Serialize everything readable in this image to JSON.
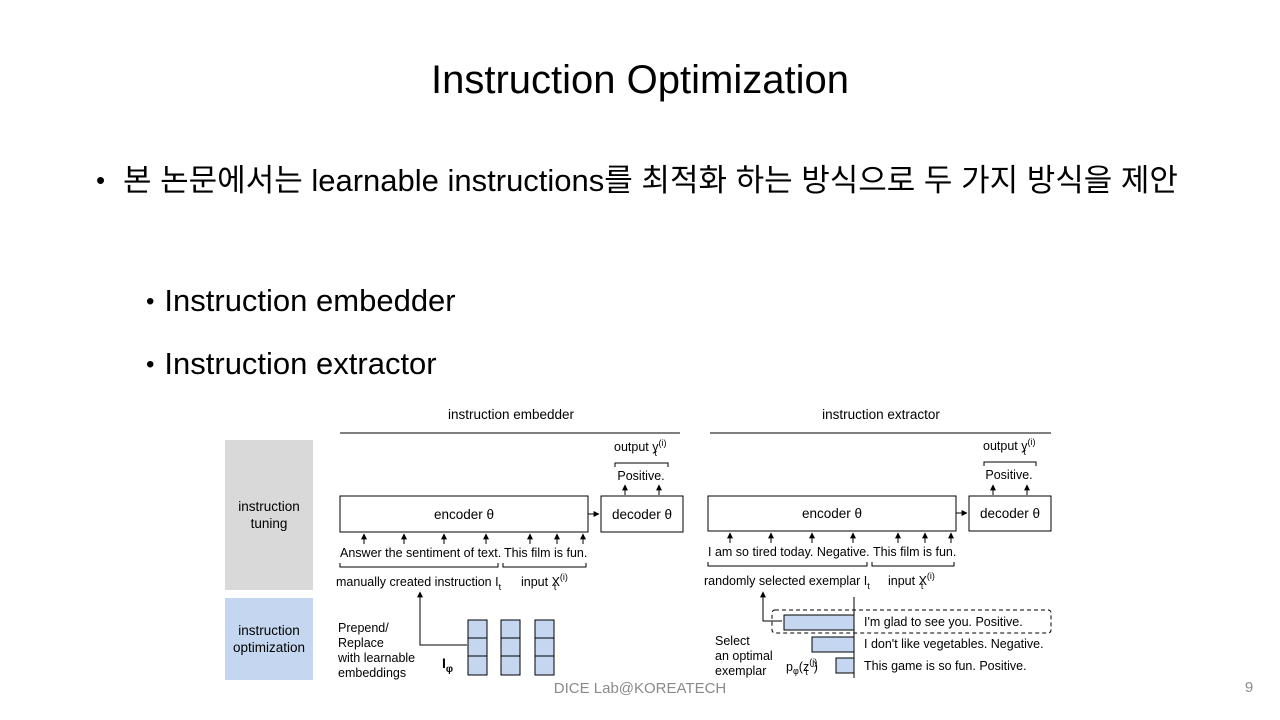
{
  "slide": {
    "title": "Instruction Optimization",
    "bullet": "본 논문에서는 learnable instructions를 최적화 하는 방식으로 두 가지 방식을 제안",
    "sub_bullets": [
      "Instruction embedder",
      "Instruction extractor"
    ],
    "footer": "DICE Lab@KOREATECH",
    "page_number": "9"
  },
  "figure": {
    "row_labels": {
      "tuning": [
        "instruction",
        "tuning"
      ],
      "optimization": [
        "instruction",
        "optimization"
      ]
    },
    "embedder": {
      "heading": "instruction embedder",
      "encoder": "encoder θ",
      "decoder": "decoder θ",
      "output_label": "output y",
      "output_sup": "(i)",
      "output_sub": "t",
      "output_value": "Positive.",
      "instruction_text": "Answer the sentiment of text.",
      "input_text": "This film is fun.",
      "instruction_caption": "manually created instruction I",
      "instruction_sub": "t",
      "input_caption": "input X",
      "input_sup": "(i)",
      "input_sub": "t",
      "opt_text": [
        "Prepend/",
        "Replace",
        "with learnable",
        "embeddings"
      ],
      "param_label": "I",
      "param_sub": "φ"
    },
    "extractor": {
      "heading": "instruction extractor",
      "encoder": "encoder θ",
      "decoder": "decoder θ",
      "output_label": "output y",
      "output_sup": "(i)",
      "output_sub": "t",
      "output_value": "Positive.",
      "instruction_text": "I am so tired today. Negative.",
      "input_text": "This film is fun.",
      "instruction_caption": "randomly selected exemplar I",
      "instruction_sub": "t",
      "input_caption": "input X",
      "input_sup": "(i)",
      "input_sub": "t",
      "select_text": [
        "Select",
        "an optimal",
        "exemplar"
      ],
      "prob_label": "p",
      "prob_sub": "φ",
      "prob_arg": "(z",
      "prob_arg_sup": "(j)",
      "prob_arg_sub": "t",
      "prob_close": ")",
      "exemplars": [
        "I'm glad to see you. Positive.",
        "I don't like vegetables. Negative.",
        "This game is so fun. Positive."
      ]
    },
    "colors": {
      "tuning_bg": "#d9d9d9",
      "optimization_bg": "#c5d7f0",
      "embedding_fill": "#c5d7f0"
    }
  }
}
